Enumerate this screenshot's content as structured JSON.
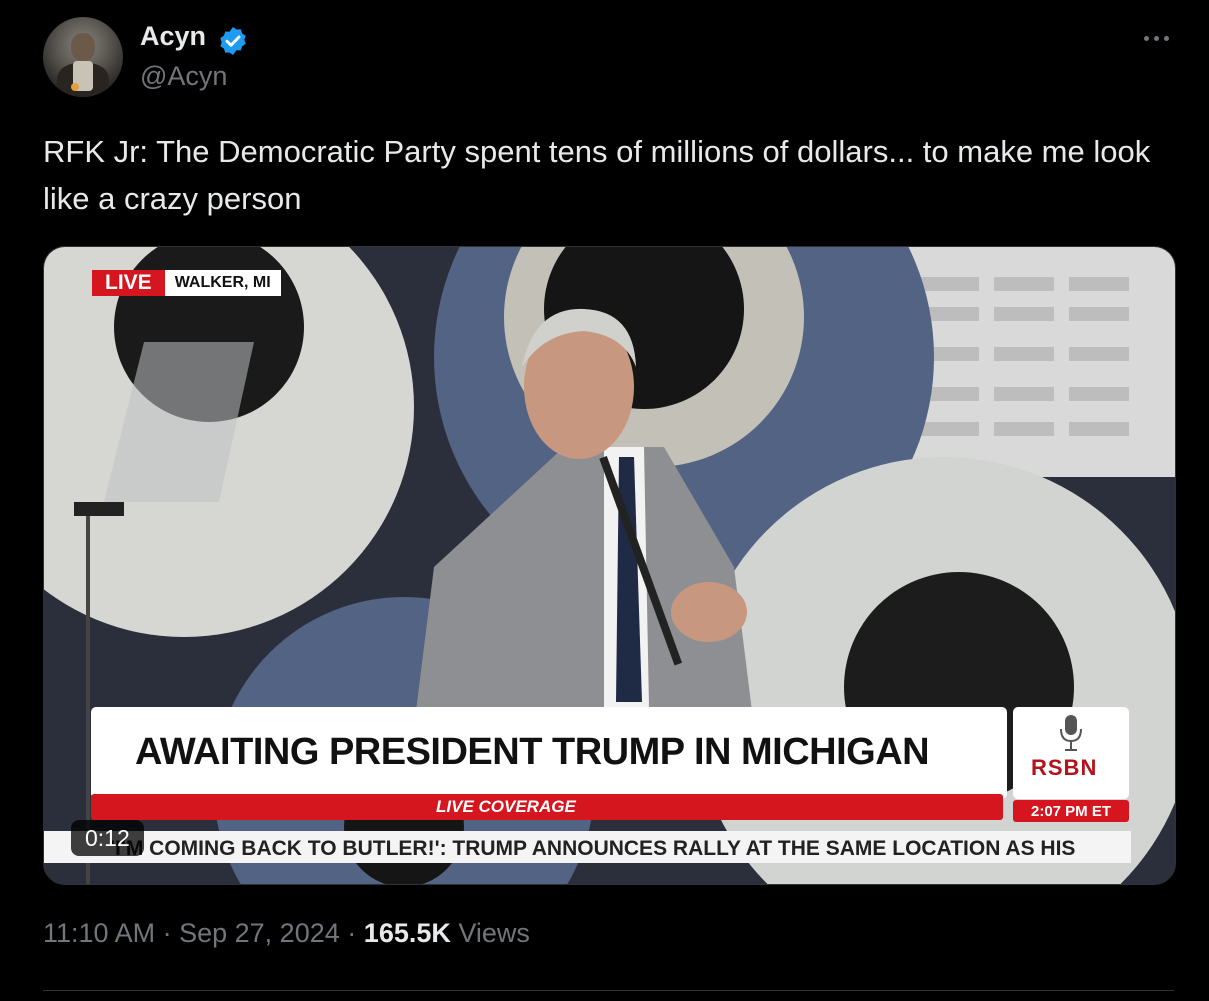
{
  "author": {
    "display_name": "Acyn",
    "handle": "@Acyn",
    "verified": true
  },
  "tweet": {
    "text": "RFK Jr: The Democratic Party spent tens of millions of dollars... to make me look like a crazy person"
  },
  "media": {
    "live_label": "LIVE",
    "location": "WALKER, MI",
    "headline": "AWAITING PRESIDENT TRUMP IN MICHIGAN",
    "coverage_label": "LIVE COVERAGE",
    "network_logo": "RSBN",
    "broadcast_time": "2:07 PM ET",
    "ticker": "'I'M COMING BACK TO BUTLER!': TRUMP ANNOUNCES RALLY AT THE SAME LOCATION AS HIS",
    "duration": "0:12"
  },
  "meta": {
    "time": "11:10 AM",
    "separator": "·",
    "date": "Sep 27, 2024",
    "views_count": "165.5K",
    "views_label": "Views"
  },
  "colors": {
    "background": "#000000",
    "verified_blue": "#1d9bf0",
    "secondary_text": "#71767b",
    "broadcast_red": "#d5161f"
  },
  "icons": [
    "verified-badge-icon",
    "more-options-icon",
    "microphone-icon"
  ]
}
